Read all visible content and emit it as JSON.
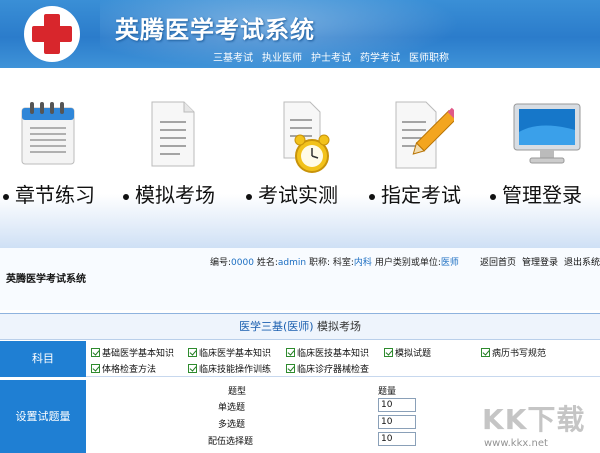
{
  "header": {
    "app_title": "英腾医学考试系统",
    "subnav": [
      "三基考试",
      "执业医师",
      "护士考试",
      "药学考试",
      "医师职称"
    ]
  },
  "menu": {
    "items": [
      {
        "label": "章节练习",
        "icon": "calendar-notebook-icon"
      },
      {
        "label": "模拟考场",
        "icon": "document-icon"
      },
      {
        "label": "考试实测",
        "icon": "alarm-clock-document-icon"
      },
      {
        "label": "指定考试",
        "icon": "pencil-document-icon"
      },
      {
        "label": "管理登录",
        "icon": "monitor-icon"
      }
    ]
  },
  "window": {
    "title": "英腾医学考试系统",
    "info": {
      "id_label": "编号:",
      "id_value": "0000",
      "name_label": "姓名:",
      "name_value": "admin",
      "title_label": "职称:",
      "dept_label": "科室:",
      "dept_value": "内科",
      "type_label": "用户类别或单位:",
      "type_value": "医师"
    },
    "links": [
      "返回首页",
      "管理登录",
      "退出系统"
    ],
    "panel_title_main": "医学三基(医师)",
    "panel_title_suffix": "模拟考场",
    "subject_label": "科目",
    "subjects": [
      "基础医学基本知识",
      "临床医学基本知识",
      "临床医技基本知识",
      "模拟试题",
      "病历书写规范",
      "体格检查方法",
      "临床技能操作训练",
      "临床诊疗器械检查"
    ],
    "settings_label": "设置试题量",
    "col_type": "题型",
    "col_count": "题量",
    "question_types": [
      {
        "name": "单选题",
        "count": "10"
      },
      {
        "name": "多选题",
        "count": "10"
      },
      {
        "name": "配伍选择题",
        "count": "10"
      }
    ]
  },
  "watermark": {
    "text": "KK下载",
    "url": "www.kkx.net"
  },
  "colors": {
    "banner": "#2b7ccb",
    "side_label": "#1f7fd3",
    "accent_text": "#1b6ec2",
    "logo_cross": "#d8262c"
  }
}
